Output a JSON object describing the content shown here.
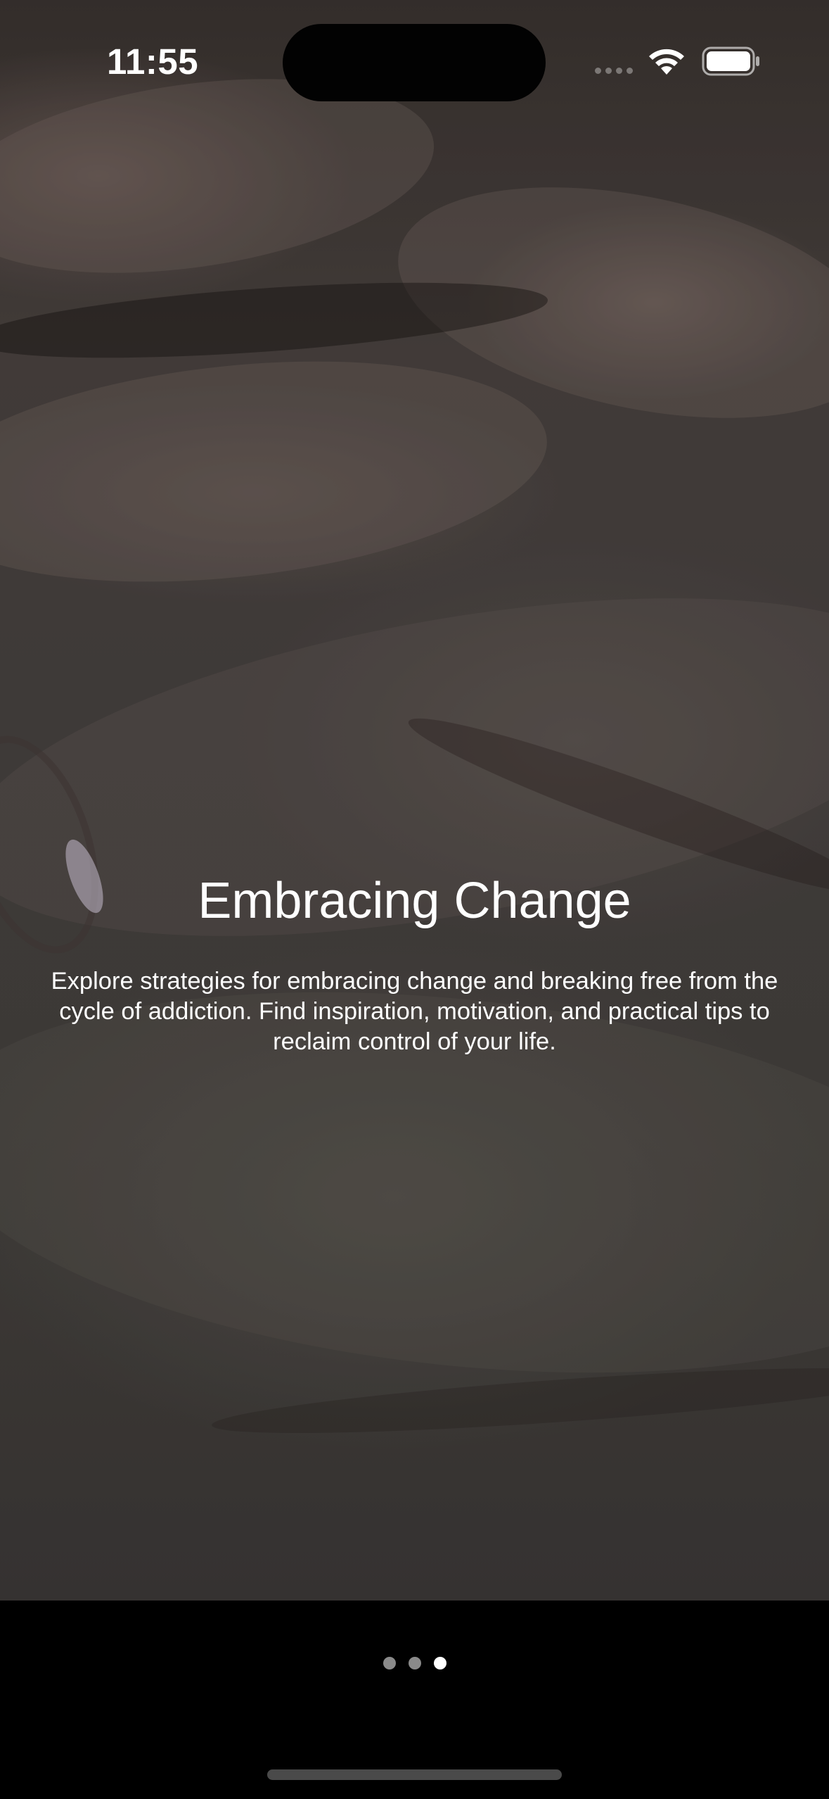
{
  "status_bar": {
    "time": "11:55"
  },
  "onboarding": {
    "title": "Embracing Change",
    "description": "Explore strategies for embracing change and breaking free from the cycle of addiction. Find inspiration, motivation, and practical tips to reclaim control of your life."
  },
  "page_indicator": {
    "total_pages": 3,
    "current_page": 3
  },
  "icons": {
    "wifi": "wifi-icon",
    "battery": "battery-icon",
    "signal": "cellular-signal-icon"
  },
  "colors": {
    "background": "#000000",
    "text": "#ffffff",
    "dot_inactive": "#8a8a8a",
    "dot_active": "#ffffff"
  }
}
